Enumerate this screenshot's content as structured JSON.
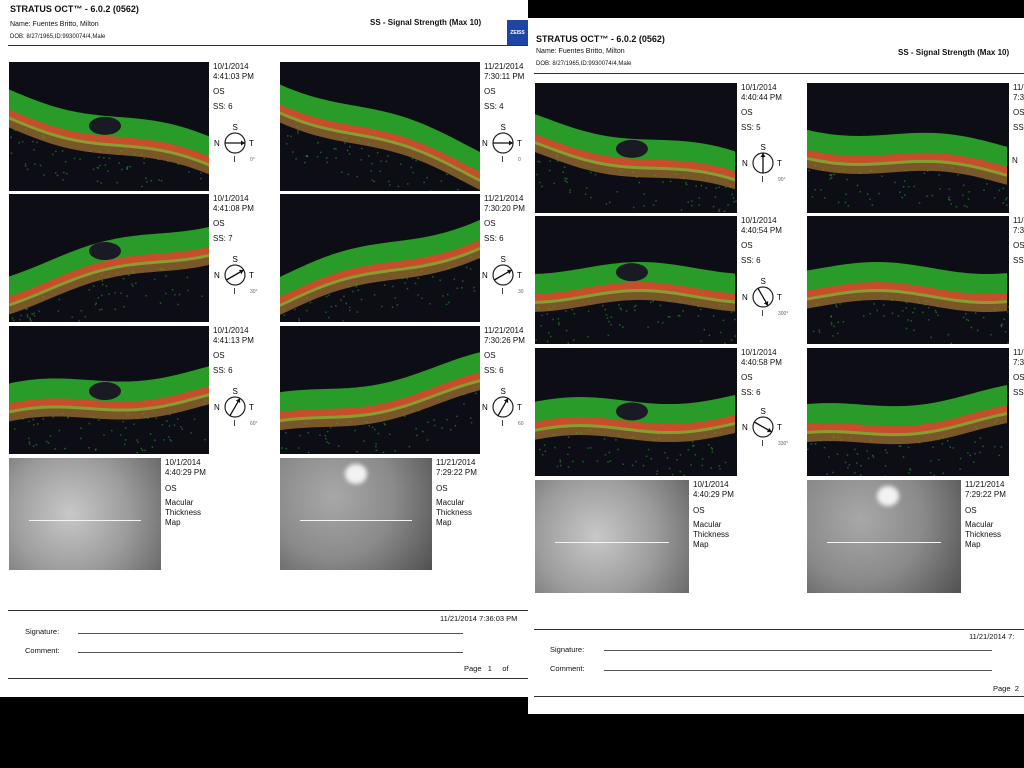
{
  "page1": {
    "title": "STRATUS OCT™ - 6.0.2 (0562)",
    "name_line": "Name:  Fuentes Britto, Milton",
    "dob_line": "DOB: 8/27/1965,ID:9930074/4,Male",
    "ss_header": "SS - Signal Strength (Max 10)",
    "logo_text": "ZEISS",
    "scans": [
      {
        "date": "10/1/2014",
        "time": "4:41:03 PM",
        "eye": "OS",
        "ss": "SS: 6",
        "angle": "0°",
        "angle_value": 0
      },
      {
        "date": "11/21/2014",
        "time": "7:30:11 PM",
        "eye": "OS",
        "ss": "SS: 4",
        "angle": "0",
        "angle_value": 0
      },
      {
        "date": "10/1/2014",
        "time": "4:41:08 PM",
        "eye": "OS",
        "ss": "SS: 7",
        "angle": "30°",
        "angle_value": 30
      },
      {
        "date": "11/21/2014",
        "time": "7:30:20 PM",
        "eye": "OS",
        "ss": "SS: 6",
        "angle": "30",
        "angle_value": 30
      },
      {
        "date": "10/1/2014",
        "time": "4:41:13 PM",
        "eye": "OS",
        "ss": "SS: 6",
        "angle": "60°",
        "angle_value": 60
      },
      {
        "date": "11/21/2014",
        "time": "7:30:26 PM",
        "eye": "OS",
        "ss": "SS: 6",
        "angle": "60",
        "angle_value": 60
      }
    ],
    "fundus": [
      {
        "date": "10/1/2014",
        "time": "4:40:29 PM",
        "eye": "OS",
        "l1": "Macular",
        "l2": "Thickness",
        "l3": "Map"
      },
      {
        "date": "11/21/2014",
        "time": "7:29:22 PM",
        "eye": "OS",
        "l1": "Macular",
        "l2": "Thickness",
        "l3": "Map"
      }
    ],
    "footer_timestamp": "11/21/2014 7:36:03 PM",
    "signature_label": "Signature:",
    "comment_label": "Comment:",
    "page_label": "Page",
    "page_number": "1",
    "page_of": "of"
  },
  "page2": {
    "title": "STRATUS OCT™ - 6.0.2 (0562)",
    "name_line": "Name:  Fuentes Britto, Milton",
    "dob_line": "DOB: 8/27/1965,ID:9930074/4,Male",
    "ss_header": "SS - Signal Strength (Max 10)",
    "scans": [
      {
        "date": "10/1/2014",
        "time": "4:40:44 PM",
        "eye": "OS",
        "ss": "SS: 5",
        "angle": "90°",
        "angle_value": 90
      },
      {
        "date": "11/",
        "time": "7:3",
        "eye": "OS",
        "ss": "SS",
        "angle": "",
        "angle_value": 90
      },
      {
        "date": "10/1/2014",
        "time": "4:40:54 PM",
        "eye": "OS",
        "ss": "SS: 6",
        "angle": "300°",
        "angle_value": 300
      },
      {
        "date": "11/",
        "time": "7:3",
        "eye": "OS",
        "ss": "SS",
        "angle": "",
        "angle_value": 300
      },
      {
        "date": "10/1/2014",
        "time": "4:40:58 PM",
        "eye": "OS",
        "ss": "SS: 6",
        "angle": "330°",
        "angle_value": 330
      },
      {
        "date": "11/",
        "time": "7:3",
        "eye": "OS",
        "ss": "SS",
        "angle": "",
        "angle_value": 330
      }
    ],
    "fundus": [
      {
        "date": "10/1/2014",
        "time": "4:40:29 PM",
        "eye": "OS",
        "l1": "Macular",
        "l2": "Thickness",
        "l3": "Map"
      },
      {
        "date": "11/21/2014",
        "time": "7:29:22 PM",
        "eye": "OS",
        "l1": "Macular",
        "l2": "Thickness",
        "l3": "Map"
      }
    ],
    "footer_timestamp": "11/21/2014 7:",
    "signature_label": "Signature:",
    "comment_label": "Comment:",
    "page_label": "Page",
    "page_number": "2"
  },
  "compass_labels": {
    "s": "S",
    "n": "N",
    "t": "T",
    "i": "I"
  },
  "colors": {
    "retina_green": "#2fb52c",
    "rpe_red": "#d8462a",
    "rpe_orange": "#e8a23a",
    "scan_bg": "#0d0d16"
  }
}
